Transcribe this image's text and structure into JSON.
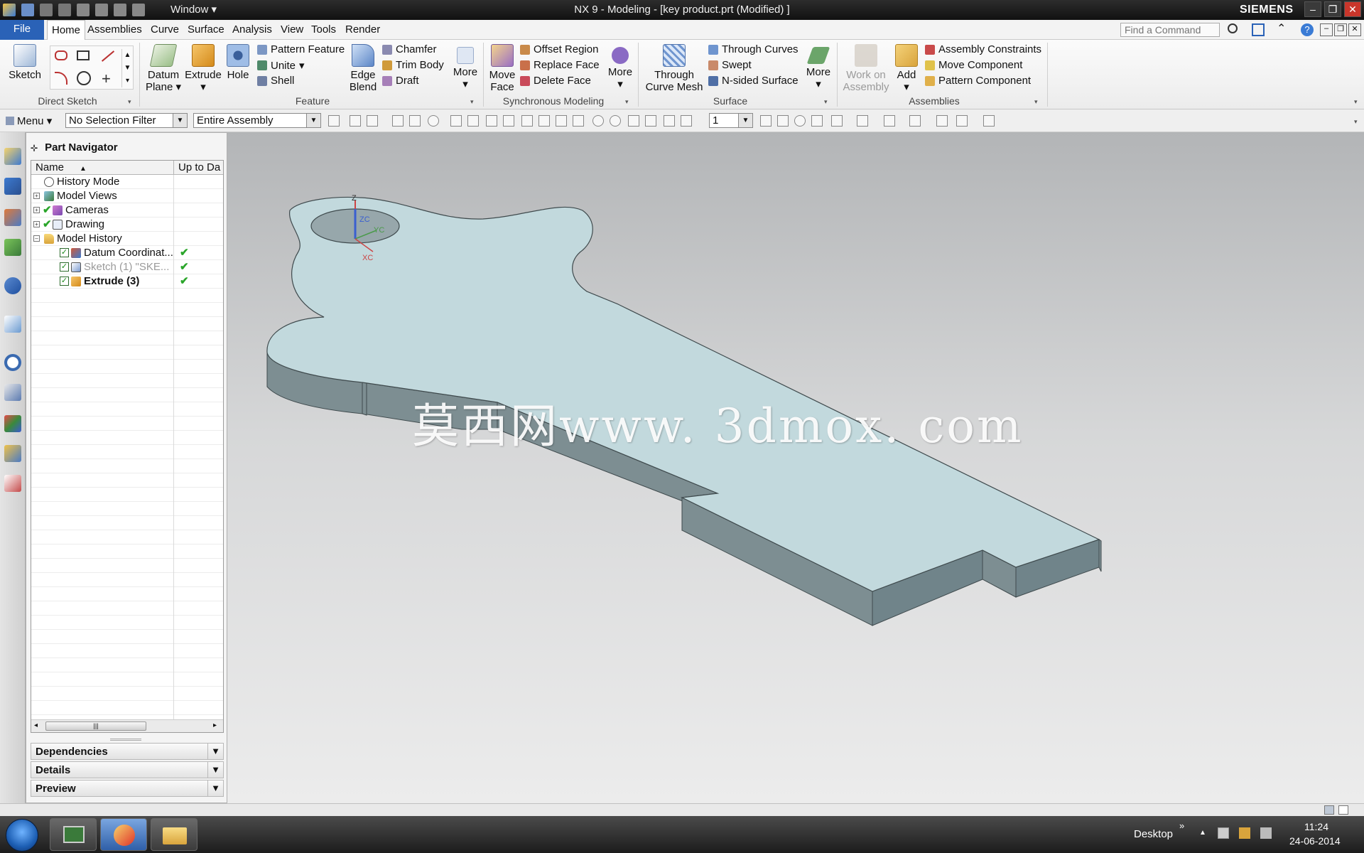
{
  "titlebar": {
    "window_menu": "Window",
    "title": "NX 9 - Modeling - [key product.prt (Modified) ]",
    "brand": "SIEMENS"
  },
  "menubar": {
    "file": "File",
    "items": [
      "Home",
      "Assemblies",
      "Curve",
      "Surface",
      "Analysis",
      "View",
      "Tools",
      "Render"
    ],
    "active": "Home",
    "find_placeholder": "Find a Command"
  },
  "ribbon": {
    "direct_sketch": {
      "label": "Direct Sketch",
      "sketch": "Sketch"
    },
    "feature": {
      "label": "Feature",
      "datum_plane": [
        "Datum",
        "Plane"
      ],
      "extrude": "Extrude",
      "hole": "Hole",
      "pattern_feature": "Pattern Feature",
      "unite": "Unite",
      "shell": "Shell",
      "edge_blend": [
        "Edge",
        "Blend"
      ],
      "chamfer": "Chamfer",
      "trim_body": "Trim Body",
      "draft": "Draft",
      "more": "More"
    },
    "synchronous": {
      "label": "Synchronous Modeling",
      "move_face": [
        "Move",
        "Face"
      ],
      "offset_region": "Offset Region",
      "replace_face": "Replace Face",
      "delete_face": "Delete Face",
      "more": "More"
    },
    "surface": {
      "label": "Surface",
      "through_curve_mesh": [
        "Through",
        "Curve Mesh"
      ],
      "through_curves": "Through Curves",
      "swept": "Swept",
      "n_sided": "N-sided Surface",
      "more": "More"
    },
    "assemblies": {
      "label": "Assemblies",
      "work_on": [
        "Work on",
        "Assembly"
      ],
      "add": "Add",
      "constraints": "Assembly Constraints",
      "move_component": "Move Component",
      "pattern_component": "Pattern Component"
    }
  },
  "selbar": {
    "menu": "Menu",
    "filter": "No Selection Filter",
    "scope": "Entire Assembly",
    "layer": "1"
  },
  "navigator": {
    "title": "Part Navigator",
    "col_name": "Name",
    "col_uptodate": "Up to Da",
    "rows": [
      {
        "label": "History Mode"
      },
      {
        "label": "Model Views"
      },
      {
        "label": "Cameras"
      },
      {
        "label": "Drawing"
      },
      {
        "label": "Model History"
      },
      {
        "label": "Datum Coordinat..."
      },
      {
        "label": "Sketch (1) \"SKE..."
      },
      {
        "label": "Extrude (3)"
      }
    ],
    "panels": [
      "Dependencies",
      "Details",
      "Preview"
    ]
  },
  "graphics": {
    "watermark": "莫西网www. 3dmox. com",
    "axis_z": "Z",
    "axis_zc": "ZC",
    "axis_yc": "YC",
    "axis_xc": "XC"
  },
  "taskbar": {
    "desktop": "Desktop",
    "time": "11:24",
    "date": "24-06-2014"
  },
  "colors": {
    "accent_file": "#2a62b7",
    "part_top": "#c2d9dd",
    "part_side": "#7d8e92",
    "check_green": "#2aa52a"
  }
}
